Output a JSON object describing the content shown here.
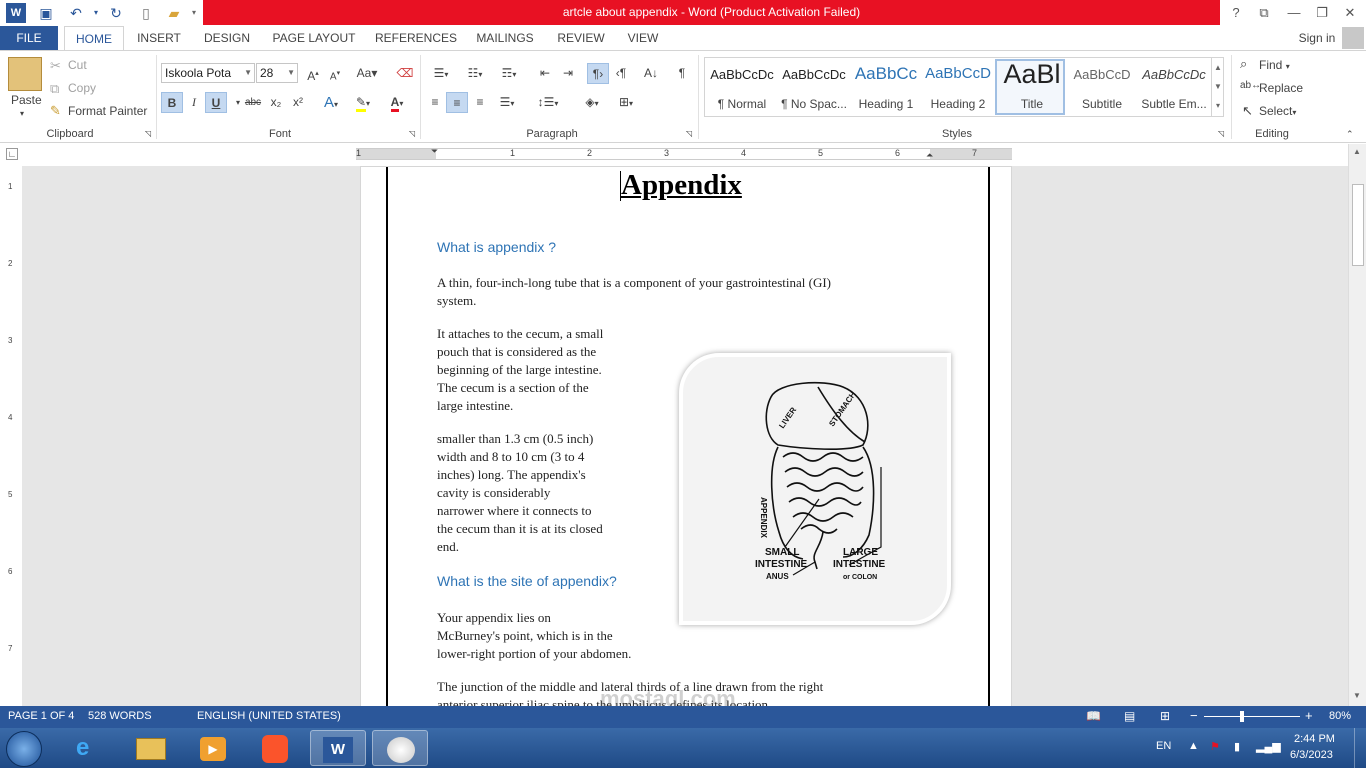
{
  "window": {
    "title": "artcle about appendix -  Word (Product Activation Failed)",
    "controls": [
      "?",
      "⧉",
      "—",
      "❐",
      "✕"
    ]
  },
  "tabs": {
    "file": "FILE",
    "items": [
      "HOME",
      "INSERT",
      "DESIGN",
      "PAGE LAYOUT",
      "REFERENCES",
      "MAILINGS",
      "REVIEW",
      "VIEW"
    ],
    "active": "HOME",
    "signin": "Sign in"
  },
  "ribbon": {
    "clipboard": {
      "label": "Clipboard",
      "paste": "Paste",
      "cut": "Cut",
      "copy": "Copy",
      "format_painter": "Format Painter"
    },
    "font": {
      "label": "Font",
      "family": "Iskoola Pota",
      "size": "28",
      "bold": "B",
      "italic": "I",
      "underline": "U",
      "strike": "abc",
      "subscript": "x₂",
      "superscript": "x²"
    },
    "paragraph": {
      "label": "Paragraph"
    },
    "styles": {
      "label": "Styles",
      "items": [
        {
          "preview": "AaBbCcDc",
          "name": "¶ Normal"
        },
        {
          "preview": "AaBbCcDc",
          "name": "¶ No Spac..."
        },
        {
          "preview": "AaBbCc",
          "name": "Heading 1"
        },
        {
          "preview": "AaBbCcD",
          "name": "Heading 2"
        },
        {
          "preview": "AaBl",
          "name": "Title"
        },
        {
          "preview": "AaBbCcD",
          "name": "Subtitle"
        },
        {
          "preview": "AaBbCcDc",
          "name": "Subtle Em..."
        }
      ],
      "selected": "Title"
    },
    "editing": {
      "label": "Editing",
      "find": "Find",
      "replace": "Replace",
      "select": "Select"
    }
  },
  "ruler": {
    "labels": [
      "1",
      "1",
      "2",
      "3",
      "4",
      "5",
      "6",
      "7"
    ],
    "vlabels": [
      "1",
      "2",
      "3",
      "4",
      "5",
      "6",
      "7"
    ]
  },
  "document": {
    "title": "Appendix",
    "heading1": "What is appendix ?",
    "p1_lines": [
      "A thin, four-inch-long tube that is a component of your gastrointestinal (GI)",
      "system."
    ],
    "p2_lines": [
      "It attaches to the cecum, a small",
      "pouch that is  considered  as the",
      "beginning of the large intestine.",
      "The cecum is a section of the",
      "large intestine."
    ],
    "p3_lines": [
      "smaller than 1.3 cm (0.5 inch)",
      "width and 8 to 10 cm (3 to 4",
      "inches) long. The appendix's",
      "cavity is considerably",
      "narrower where it connects to",
      "the cecum than it is at its closed",
      "end."
    ],
    "heading2": "What is the site of appendix?",
    "p4_lines": [
      "Your appendix lies on",
      "McBurney's point, which is in the",
      "lower-right portion of your abdomen."
    ],
    "p5_lines": [
      "The junction of the middle and lateral thirds of a line drawn from the right",
      "anterior superior iliac spine to the umbilicus defines its location."
    ],
    "figure_labels": {
      "liver": "LIVER",
      "stomach": "STOMACH",
      "appendix": "APPENDIX",
      "small1": "SMALL",
      "small2": "INTESTINE",
      "anus": "ANUS",
      "large1": "LARGE",
      "large2": "INTESTINE",
      "colon": "or COLON"
    }
  },
  "statusbar": {
    "page": "PAGE 1 OF 4",
    "words": "528 WORDS",
    "language": "ENGLISH (UNITED STATES)",
    "zoom": "80%"
  },
  "taskbar": {
    "lang": "EN",
    "time": "2:44 PM",
    "date": "6/3/2023"
  },
  "watermark": "mostaql.com",
  "colors": {
    "accent": "#2b579a",
    "title_bar_alert": "#e81123",
    "heading": "#2e74b5"
  }
}
